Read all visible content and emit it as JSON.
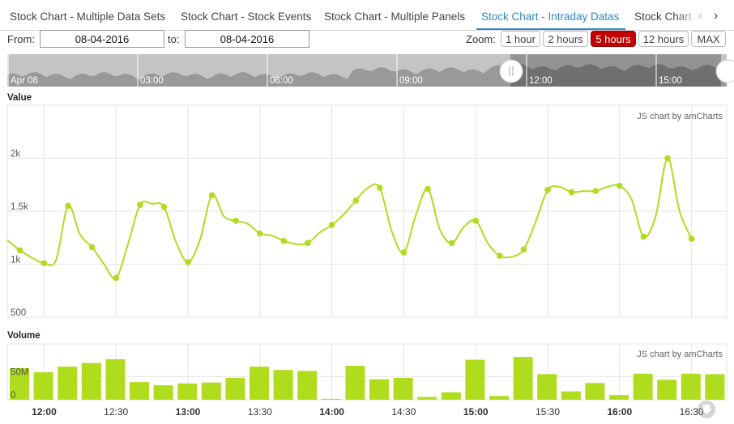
{
  "tabs": [
    {
      "label": "Stock Chart - Multiple Data Sets",
      "active": false
    },
    {
      "label": "Stock Chart - Stock Events",
      "active": false
    },
    {
      "label": "Stock Chart - Multiple Panels",
      "active": false
    },
    {
      "label": "Stock Chart - Intraday Datas",
      "active": true
    },
    {
      "label": "Stock Chart",
      "active": false
    }
  ],
  "nav": {
    "prev_icon": "chevron-left-icon",
    "next_icon": "chevron-right-icon"
  },
  "period": {
    "from_label": "From:",
    "from_value": "08-04-2016",
    "to_label": "to:",
    "to_value": "08-04-2016",
    "zoom_label": "Zoom:",
    "buttons": [
      "1 hour",
      "2 hours",
      "5 hours",
      "12 hours",
      "MAX"
    ],
    "selected": "5 hours"
  },
  "scrollbar": {
    "labels": [
      "Apr 08",
      "03:00",
      "06:00",
      "09:00",
      "12:00",
      "15:00"
    ],
    "handle_icon": "scroll-handle-grip-icon"
  },
  "colors": {
    "line": "#b0dc1e",
    "bar": "#b0dc1e",
    "selected_zoom": "#c10000",
    "active_tab": "#2f86c7"
  },
  "chart_data": [
    {
      "type": "line",
      "title": "Value",
      "credit": "JS chart by amCharts",
      "x": [
        "11:45",
        "11:50",
        "11:55",
        "12:00",
        "12:05",
        "12:10",
        "12:15",
        "12:20",
        "12:25",
        "12:30",
        "12:35",
        "12:40",
        "12:45",
        "12:50",
        "12:55",
        "13:00",
        "13:05",
        "13:10",
        "13:15",
        "13:20",
        "13:25",
        "13:30",
        "13:35",
        "13:40",
        "13:45",
        "13:50",
        "13:55",
        "14:00",
        "14:05",
        "14:10",
        "14:15",
        "14:20",
        "14:25",
        "14:30",
        "14:35",
        "14:40",
        "14:45",
        "14:50",
        "14:55",
        "15:00",
        "15:05",
        "15:10",
        "15:15",
        "15:20",
        "15:25",
        "15:30",
        "15:35",
        "15:40",
        "15:45",
        "15:50",
        "15:55",
        "16:00",
        "16:05",
        "16:10",
        "16:15",
        "16:20",
        "16:25",
        "16:30"
      ],
      "values": [
        1220,
        1130,
        1060,
        1010,
        1040,
        1550,
        1280,
        1160,
        1000,
        870,
        1190,
        1560,
        1570,
        1540,
        1210,
        1020,
        1230,
        1650,
        1450,
        1410,
        1380,
        1290,
        1270,
        1220,
        1190,
        1200,
        1300,
        1370,
        1470,
        1600,
        1720,
        1720,
        1310,
        1110,
        1460,
        1710,
        1330,
        1200,
        1350,
        1410,
        1200,
        1080,
        1070,
        1140,
        1400,
        1700,
        1730,
        1680,
        1690,
        1690,
        1730,
        1740,
        1610,
        1260,
        1450,
        2000,
        1500,
        1240
      ],
      "y_ticks": [
        "500",
        "1k",
        "1.5k",
        "2k"
      ],
      "ylim": [
        500,
        2500
      ]
    },
    {
      "type": "bar",
      "title": "Volume",
      "credit": "JS chart by amCharts",
      "x": [
        "11:45",
        "11:50",
        "11:55",
        "12:00",
        "12:05",
        "12:10",
        "12:15",
        "12:20",
        "12:25",
        "12:30",
        "12:35",
        "12:40",
        "12:45",
        "12:50",
        "12:55",
        "13:00",
        "13:05",
        "13:10",
        "13:15",
        "13:20",
        "13:25",
        "13:30",
        "13:35",
        "13:40",
        "13:45",
        "13:50",
        "13:55",
        "14:00",
        "14:05",
        "14:10",
        "14:15",
        "14:20",
        "14:25",
        "14:30",
        "14:35",
        "14:40",
        "14:45",
        "14:50",
        "14:55",
        "15:00",
        "15:05",
        "15:10",
        "15:15",
        "15:20",
        "15:25",
        "15:30",
        "15:35",
        "15:40",
        "15:45",
        "15:50",
        "15:55",
        "16:00",
        "16:05",
        "16:10",
        "16:15",
        "16:20",
        "16:25",
        "16:30"
      ],
      "values": [
        68,
        59,
        71,
        79,
        87,
        38,
        31,
        35,
        37,
        47,
        71,
        64,
        62,
        2,
        73,
        44,
        47,
        6,
        16,
        86,
        8,
        92,
        55,
        18,
        36,
        10,
        56,
        43,
        56,
        55
      ],
      "y_ticks": [
        "0",
        "50M"
      ],
      "ylim": [
        0,
        120
      ]
    }
  ],
  "x_axis": {
    "ticks": [
      "12:00",
      "12:30",
      "13:00",
      "13:30",
      "14:00",
      "14:30",
      "15:00",
      "15:30",
      "16:00",
      "16:30"
    ],
    "bold": [
      true,
      false,
      true,
      false,
      true,
      false,
      true,
      false,
      true,
      false
    ]
  },
  "download_icon": "download-arrow-icon"
}
